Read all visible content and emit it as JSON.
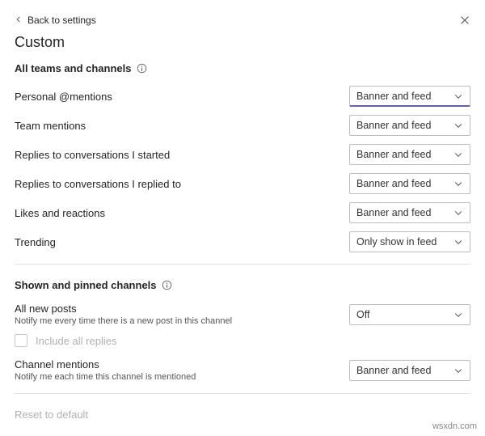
{
  "back_label": "Back to settings",
  "title": "Custom",
  "section1": {
    "heading": "All teams and channels",
    "rows": [
      {
        "label": "Personal @mentions",
        "value": "Banner and feed"
      },
      {
        "label": "Team mentions",
        "value": "Banner and feed"
      },
      {
        "label": "Replies to conversations I started",
        "value": "Banner and feed"
      },
      {
        "label": "Replies to conversations I replied to",
        "value": "Banner and feed"
      },
      {
        "label": "Likes and reactions",
        "value": "Banner and feed"
      },
      {
        "label": "Trending",
        "value": "Only show in feed"
      }
    ]
  },
  "section2": {
    "heading": "Shown and pinned channels",
    "all_new_posts": {
      "label": "All new posts",
      "sub": "Notify me every time there is a new post in this channel",
      "value": "Off"
    },
    "include_replies_label": "Include all replies",
    "channel_mentions": {
      "label": "Channel mentions",
      "sub": "Notify me each time this channel is mentioned",
      "value": "Banner and feed"
    }
  },
  "reset_label": "Reset to default",
  "watermark": "wsxdn.com"
}
